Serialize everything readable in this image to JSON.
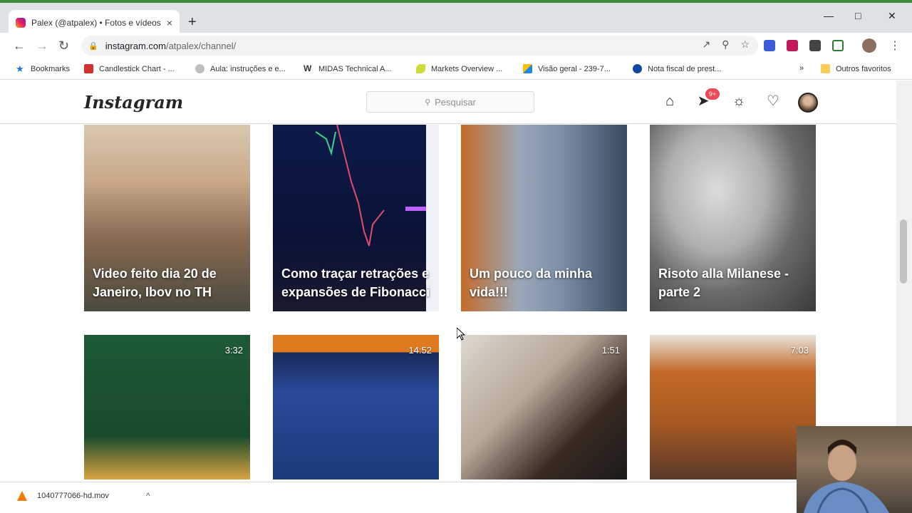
{
  "browser": {
    "tab_title": "Palex (@atpalex) • Fotos e vídeos",
    "tab_close": "×",
    "new_tab": "+",
    "url_host": "instagram.com",
    "url_path": "/atpalex/channel/",
    "bookmarks": [
      {
        "label": "Bookmarks",
        "color": "#1a73e8"
      },
      {
        "label": "Candlestick Chart - ...",
        "color": "#d32f2f"
      },
      {
        "label": "Aula: instruções e e...",
        "color": "#9e9e9e"
      },
      {
        "label": "MIDAS Technical A...",
        "color": "#333333"
      },
      {
        "label": "Markets Overview ...",
        "color": "#cddc39"
      },
      {
        "label": "Visão geral - 239-7...",
        "color": "#1e88e5"
      },
      {
        "label": "Nota fiscal de prest...",
        "color": "#0d47a1"
      }
    ],
    "bookmarks_overflow": "»",
    "other_bookmarks": "Outros favoritos"
  },
  "instagram": {
    "logo": "Instagram",
    "search_placeholder": "Pesquisar",
    "notification_badge": "9+",
    "tiles": [
      {
        "caption": "Video feito dia 20 de Janeiro, Ibov no TH",
        "duration": ""
      },
      {
        "caption": "Como traçar retrações e expansões de Fibonacci",
        "duration": ""
      },
      {
        "caption": "Um pouco da minha vida!!!",
        "duration": ""
      },
      {
        "caption": "Risoto alla Milanese - parte 2",
        "duration": ""
      },
      {
        "caption": "",
        "duration": "3:32"
      },
      {
        "caption": "",
        "duration": "14:52"
      },
      {
        "caption": "",
        "duration": "1:51"
      },
      {
        "caption": "",
        "duration": "7:03"
      }
    ]
  },
  "downloads": {
    "file": "1040777066-hd.mov",
    "caret": "^"
  }
}
